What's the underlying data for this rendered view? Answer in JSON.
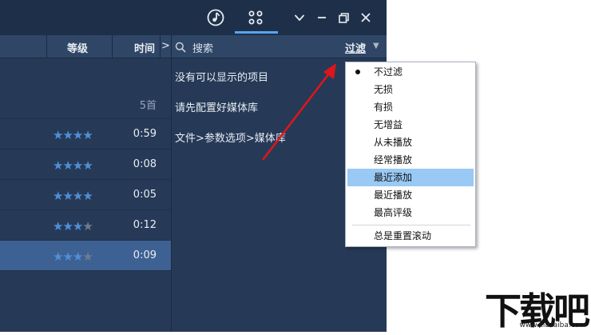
{
  "colors": {
    "accent": "#5aa4f0",
    "star": "#4f8fd8",
    "highlight": "#99c9f4",
    "arrow": "#e0151b"
  },
  "titlebar": {
    "tabs": [
      {
        "icon": "music-note-icon",
        "active": false
      },
      {
        "icon": "grid-icon",
        "active": true
      }
    ],
    "controls": [
      "chevron-down-icon",
      "minimize-icon",
      "restore-icon",
      "close-icon"
    ]
  },
  "header": {
    "rating": "等级",
    "time": "时间",
    "more": ">",
    "search_placeholder": "搜索",
    "filter": "过滤",
    "filter_arrow": "▼"
  },
  "left": {
    "count": "5首",
    "rows": [
      {
        "rating": 4,
        "time": "0:59",
        "selected": false
      },
      {
        "rating": 4,
        "time": "0:08",
        "selected": false
      },
      {
        "rating": 4,
        "time": "0:05",
        "selected": false
      },
      {
        "rating": 3,
        "time": "0:12",
        "selected": false
      },
      {
        "rating": 3,
        "time": "0:09",
        "selected": true
      }
    ]
  },
  "right": {
    "messages": [
      "没有可以显示的项目",
      "请先配置好媒体库",
      "文件>参数选项>媒体库"
    ]
  },
  "filter_menu": {
    "items": [
      {
        "label": "不过滤",
        "checked": true
      },
      {
        "label": "无损"
      },
      {
        "label": "有损"
      },
      {
        "label": "无增益"
      },
      {
        "label": "从未播放"
      },
      {
        "label": "经常播放"
      },
      {
        "label": "最近添加",
        "highlighted": true
      },
      {
        "label": "最近播放"
      },
      {
        "label": "最高评级"
      }
    ],
    "footer": "总是重置滚动"
  },
  "watermark": {
    "main": "下载吧",
    "url": "www.xiazaiba.com"
  }
}
